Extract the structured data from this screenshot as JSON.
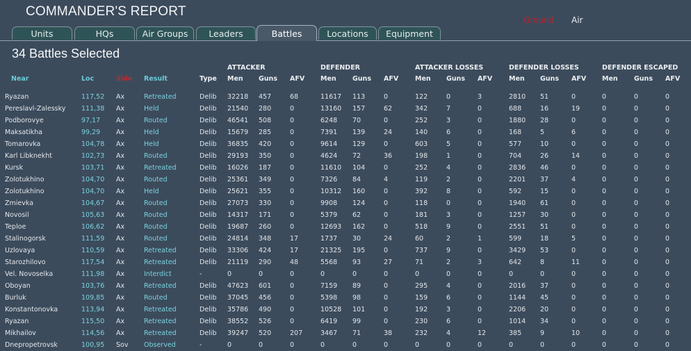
{
  "header": {
    "title": "COMMANDER'S REPORT",
    "toggle_ground": "Ground",
    "toggle_air": "Air"
  },
  "tabs": [
    "Units",
    "HQs",
    "Air Groups",
    "Leaders",
    "Battles",
    "Locations",
    "Equipment"
  ],
  "active_tab": "Battles",
  "summary": "34 Battles Selected",
  "column_groups": {
    "attacker": "ATTACKER",
    "defender": "DEFENDER",
    "attacker_losses": "ATTACKER LOSSES",
    "defender_losses": "DEFENDER LOSSES",
    "defender_escaped": "DEFENDER ESCAPED"
  },
  "columns": {
    "near": "Near",
    "loc": "Loc",
    "side": "Side",
    "result": "Result",
    "type": "Type",
    "att_men": "Men",
    "att_guns": "Guns",
    "att_afv": "AFV",
    "def_men": "Men",
    "def_guns": "Guns",
    "def_afv": "AFV",
    "al_men": "Men",
    "al_guns": "Guns",
    "al_afv": "AFV",
    "dl_men": "Men",
    "dl_guns": "Guns",
    "dl_afv": "AFV",
    "de_men": "Men",
    "de_guns": "Guns",
    "de_afv": "AFV"
  },
  "rows": [
    {
      "near": "Ryazan",
      "loc": "117,52",
      "side": "Ax",
      "result": "Retreated",
      "type": "Delib",
      "vals": [
        "32218",
        "457",
        "68",
        "11617",
        "113",
        "0",
        "122",
        "0",
        "3",
        "2810",
        "51",
        "0",
        "0",
        "0",
        "0"
      ]
    },
    {
      "near": "Pereslavl-Zalessky",
      "loc": "111,38",
      "side": "Ax",
      "result": "Held",
      "type": "Delib",
      "vals": [
        "21540",
        "280",
        "0",
        "13160",
        "157",
        "62",
        "342",
        "7",
        "0",
        "688",
        "16",
        "19",
        "0",
        "0",
        "0"
      ]
    },
    {
      "near": "Podborovye",
      "loc": "97,17",
      "side": "Ax",
      "result": "Routed",
      "type": "Delib",
      "vals": [
        "46541",
        "508",
        "0",
        "6248",
        "70",
        "0",
        "252",
        "3",
        "0",
        "1880",
        "28",
        "0",
        "0",
        "0",
        "0"
      ]
    },
    {
      "near": "Maksatikha",
      "loc": "99,29",
      "side": "Ax",
      "result": "Held",
      "type": "Delib",
      "vals": [
        "15679",
        "285",
        "0",
        "7391",
        "139",
        "24",
        "140",
        "6",
        "0",
        "168",
        "5",
        "6",
        "0",
        "0",
        "0"
      ]
    },
    {
      "near": "Tomarovka",
      "loc": "104,78",
      "side": "Ax",
      "result": "Held",
      "type": "Delib",
      "vals": [
        "36835",
        "420",
        "0",
        "9614",
        "129",
        "0",
        "603",
        "5",
        "0",
        "577",
        "10",
        "0",
        "0",
        "0",
        "0"
      ]
    },
    {
      "near": "Karl Libknekht",
      "loc": "102,73",
      "side": "Ax",
      "result": "Routed",
      "type": "Delib",
      "vals": [
        "29193",
        "350",
        "0",
        "4624",
        "72",
        "36",
        "198",
        "1",
        "0",
        "704",
        "26",
        "14",
        "0",
        "0",
        "0"
      ]
    },
    {
      "near": "Kursk",
      "loc": "103,71",
      "side": "Ax",
      "result": "Retreated",
      "type": "Delib",
      "vals": [
        "16026",
        "187",
        "0",
        "11610",
        "104",
        "0",
        "252",
        "4",
        "0",
        "2836",
        "46",
        "0",
        "0",
        "0",
        "0"
      ]
    },
    {
      "near": "Zolotukhino",
      "loc": "104,70",
      "side": "Ax",
      "result": "Routed",
      "type": "Delib",
      "vals": [
        "25361",
        "349",
        "0",
        "7326",
        "84",
        "4",
        "119",
        "2",
        "0",
        "2201",
        "37",
        "4",
        "0",
        "0",
        "0"
      ]
    },
    {
      "near": "Zolotukhino",
      "loc": "104,70",
      "side": "Ax",
      "result": "Held",
      "type": "Delib",
      "vals": [
        "25621",
        "355",
        "0",
        "10312",
        "160",
        "0",
        "392",
        "8",
        "0",
        "592",
        "15",
        "0",
        "0",
        "0",
        "0"
      ]
    },
    {
      "near": "Zmievka",
      "loc": "104,67",
      "side": "Ax",
      "result": "Routed",
      "type": "Delib",
      "vals": [
        "27073",
        "330",
        "0",
        "9908",
        "124",
        "0",
        "118",
        "0",
        "0",
        "1940",
        "61",
        "0",
        "0",
        "0",
        "0"
      ]
    },
    {
      "near": "Novosil",
      "loc": "105,63",
      "side": "Ax",
      "result": "Routed",
      "type": "Delib",
      "vals": [
        "14317",
        "171",
        "0",
        "5379",
        "62",
        "0",
        "181",
        "3",
        "0",
        "1257",
        "30",
        "0",
        "0",
        "0",
        "0"
      ]
    },
    {
      "near": "Teploe",
      "loc": "106,62",
      "side": "Ax",
      "result": "Routed",
      "type": "Delib",
      "vals": [
        "19687",
        "260",
        "0",
        "12693",
        "162",
        "0",
        "518",
        "9",
        "0",
        "2551",
        "51",
        "0",
        "0",
        "0",
        "0"
      ]
    },
    {
      "near": "Stalinogorsk",
      "loc": "111,59",
      "side": "Ax",
      "result": "Routed",
      "type": "Delib",
      "vals": [
        "24814",
        "348",
        "17",
        "1737",
        "30",
        "24",
        "60",
        "2",
        "1",
        "599",
        "18",
        "5",
        "0",
        "0",
        "0"
      ]
    },
    {
      "near": "Uzlovaya",
      "loc": "110,59",
      "side": "Ax",
      "result": "Retreated",
      "type": "Delib",
      "vals": [
        "33306",
        "424",
        "17",
        "21325",
        "195",
        "0",
        "737",
        "9",
        "0",
        "3429",
        "53",
        "0",
        "0",
        "0",
        "0"
      ]
    },
    {
      "near": "Starozhilovo",
      "loc": "117,54",
      "side": "Ax",
      "result": "Retreated",
      "type": "Delib",
      "vals": [
        "21119",
        "290",
        "48",
        "5568",
        "93",
        "27",
        "71",
        "2",
        "3",
        "642",
        "8",
        "11",
        "0",
        "0",
        "0"
      ]
    },
    {
      "near": "Vel. Novoselka",
      "loc": "111,98",
      "side": "Ax",
      "result": "Interdict",
      "type": "-",
      "vals": [
        "0",
        "0",
        "0",
        "0",
        "0",
        "0",
        "0",
        "0",
        "0",
        "0",
        "0",
        "0",
        "0",
        "0",
        "0"
      ]
    },
    {
      "near": "Oboyan",
      "loc": "103,76",
      "side": "Ax",
      "result": "Retreated",
      "type": "Delib",
      "vals": [
        "47623",
        "601",
        "0",
        "7159",
        "89",
        "0",
        "295",
        "4",
        "0",
        "2016",
        "37",
        "0",
        "0",
        "0",
        "0"
      ]
    },
    {
      "near": "Burluk",
      "loc": "109,85",
      "side": "Ax",
      "result": "Routed",
      "type": "Delib",
      "vals": [
        "37045",
        "456",
        "0",
        "5398",
        "98",
        "0",
        "159",
        "6",
        "0",
        "1144",
        "45",
        "0",
        "0",
        "0",
        "0"
      ]
    },
    {
      "near": "Konstantonovka",
      "loc": "113,94",
      "side": "Ax",
      "result": "Retreated",
      "type": "Delib",
      "vals": [
        "35786",
        "490",
        "0",
        "10528",
        "101",
        "0",
        "192",
        "3",
        "0",
        "2206",
        "20",
        "0",
        "0",
        "0",
        "0"
      ]
    },
    {
      "near": "Ryazan",
      "loc": "115,50",
      "side": "Ax",
      "result": "Retreated",
      "type": "Delib",
      "vals": [
        "38552",
        "526",
        "0",
        "6419",
        "99",
        "0",
        "230",
        "6",
        "0",
        "1014",
        "34",
        "0",
        "0",
        "0",
        "0"
      ]
    },
    {
      "near": "Mikhailov",
      "loc": "114,56",
      "side": "Ax",
      "result": "Retreated",
      "type": "Delib",
      "vals": [
        "39247",
        "520",
        "207",
        "3467",
        "71",
        "38",
        "232",
        "4",
        "12",
        "385",
        "9",
        "10",
        "0",
        "0",
        "0"
      ]
    },
    {
      "near": "Dnepropetrovsk",
      "loc": "100,95",
      "side": "Sov",
      "result": "Observed",
      "type": "-",
      "vals": [
        "0",
        "0",
        "0",
        "0",
        "0",
        "0",
        "0",
        "0",
        "0",
        "0",
        "0",
        "0",
        "0",
        "0",
        "0"
      ]
    }
  ]
}
